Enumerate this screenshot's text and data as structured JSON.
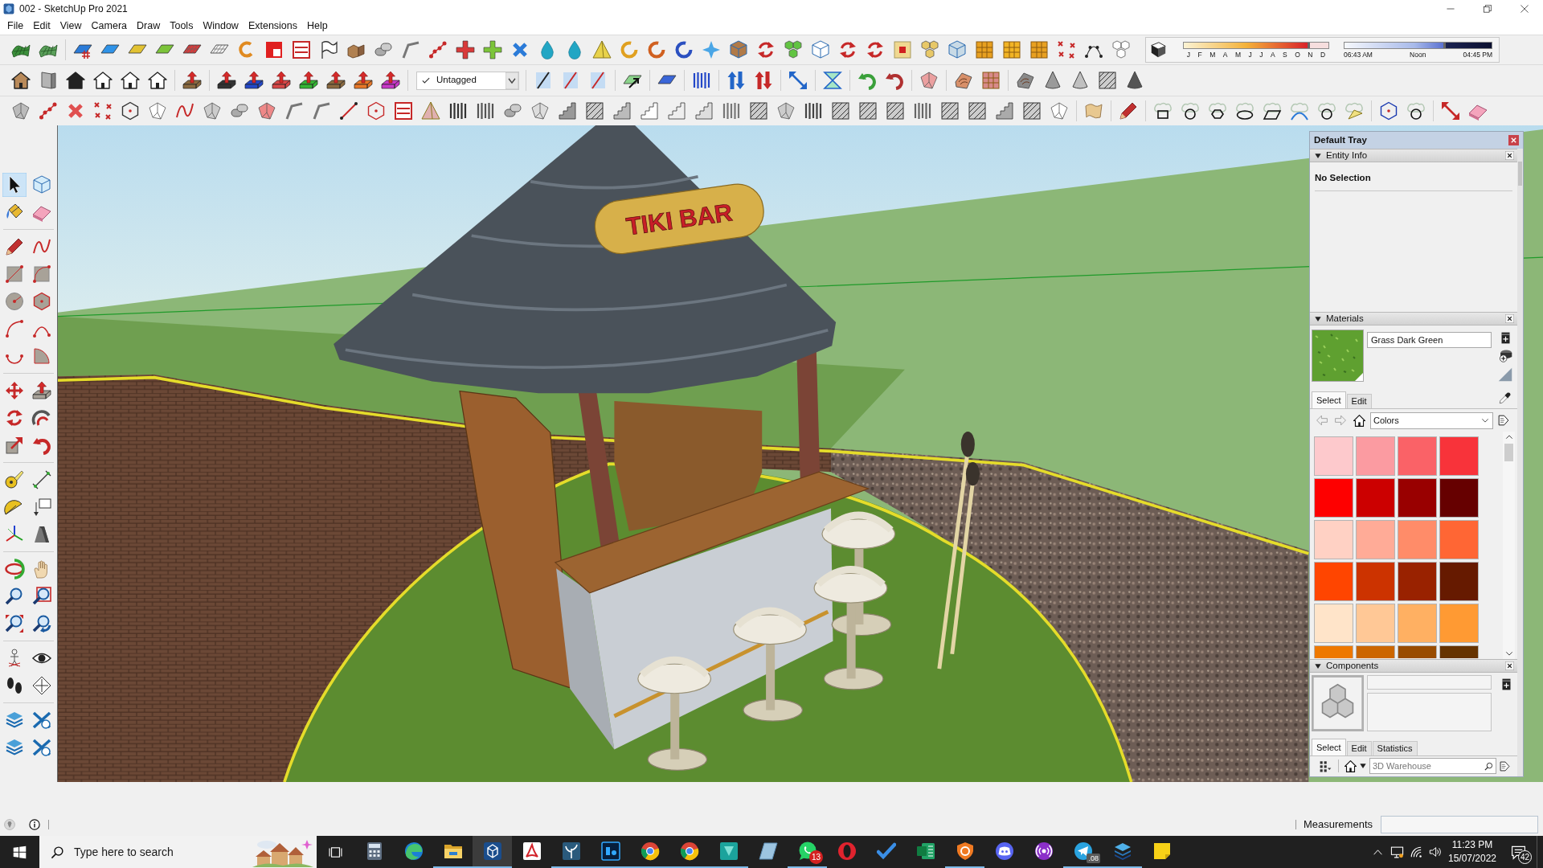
{
  "window": {
    "title": "002 - SketchUp Pro 2021"
  },
  "menu": [
    "File",
    "Edit",
    "View",
    "Camera",
    "Draw",
    "Tools",
    "Window",
    "Extensions",
    "Help"
  ],
  "toolbar": {
    "tag_dropdown": {
      "value": "Untagged"
    }
  },
  "shadow_settings": {
    "date_slider": {
      "level": 0.86,
      "months": [
        "J",
        "F",
        "M",
        "A",
        "M",
        "J",
        "J",
        "A",
        "S",
        "O",
        "N",
        "D"
      ]
    },
    "time_slider": {
      "level": 0.68,
      "start": "06:43 AM",
      "middle": "Noon",
      "end": "04:45 PM"
    }
  },
  "left_toolbar": {
    "tool_groups": [
      [
        {
          "selected": true
        },
        {
          "selected": false
        },
        {
          "selected": false
        },
        {
          "selected": false
        }
      ],
      [
        {
          "selected": false
        },
        {
          "selected": false
        },
        {
          "selected": false
        },
        {
          "selected": false
        },
        {
          "selected": false
        },
        {
          "selected": false
        },
        {
          "selected": false
        },
        {
          "selected": false
        },
        {
          "selected": false
        },
        {
          "selected": false
        }
      ],
      [
        {
          "selected": false
        },
        {
          "selected": false
        },
        {
          "selected": false
        },
        {
          "selected": false
        },
        {
          "selected": false
        },
        {
          "selected": false
        }
      ],
      [
        {
          "selected": false
        },
        {
          "selected": false
        },
        {
          "selected": false
        },
        {
          "selected": false
        },
        {
          "selected": false
        },
        {
          "selected": false
        }
      ],
      [
        {
          "selected": false
        },
        {
          "selected": false
        },
        {
          "selected": false
        },
        {
          "selected": false
        },
        {
          "selected": false
        },
        {
          "selected": false
        }
      ],
      [
        {
          "selected": false
        },
        {
          "selected": false
        },
        {
          "selected": false
        },
        {
          "selected": false
        }
      ],
      [
        {
          "selected": false
        },
        {
          "selected": false
        },
        {
          "selected": false
        },
        {
          "selected": false
        }
      ]
    ]
  },
  "viewport": {
    "sign_text": "TIKI BAR"
  },
  "tray": {
    "title": "Default Tray",
    "entity_info": {
      "title": "Entity Info",
      "selection": "No Selection"
    },
    "materials": {
      "title": "Materials",
      "name": "Grass Dark Green",
      "tabs": [
        {
          "label": "Select",
          "selected": true
        },
        {
          "label": "Edit",
          "selected": false
        }
      ],
      "library": "Colors",
      "swatches": [
        {
          "color": "#fdc9cc"
        },
        {
          "color": "#fb9ba1"
        },
        {
          "color": "#fa6267"
        },
        {
          "color": "#f8333a"
        },
        {
          "color": "#fe0000"
        },
        {
          "color": "#cc0000"
        },
        {
          "color": "#990000"
        },
        {
          "color": "#660000"
        },
        {
          "color": "#ffd1c4"
        },
        {
          "color": "#ffab97"
        },
        {
          "color": "#ff8c69"
        },
        {
          "color": "#ff6634"
        },
        {
          "color": "#ff4500"
        },
        {
          "color": "#cc3300"
        },
        {
          "color": "#992200"
        },
        {
          "color": "#661a00"
        },
        {
          "color": "#ffe4c9"
        },
        {
          "color": "#ffc896"
        },
        {
          "color": "#ffb062"
        },
        {
          "color": "#ff9a33"
        },
        {
          "color": "#ee7800"
        },
        {
          "color": "#cc6600"
        },
        {
          "color": "#994c00"
        },
        {
          "color": "#663300"
        }
      ]
    },
    "components": {
      "title": "Components",
      "tabs": [
        {
          "label": "Select",
          "selected": true
        },
        {
          "label": "Edit",
          "selected": false
        },
        {
          "label": "Statistics",
          "selected": false
        }
      ],
      "search": {
        "placeholder": "3D Warehouse"
      }
    }
  },
  "status_bar": {
    "measurements_label": "Measurements"
  },
  "taskbar": {
    "search": {
      "placeholder": "Type here to search"
    },
    "apps": [
      {
        "running": false,
        "selected": false
      },
      {
        "running": false,
        "selected": false
      },
      {
        "running": true,
        "selected": false
      },
      {
        "running": true,
        "selected": true
      },
      {
        "running": false,
        "selected": false
      },
      {
        "running": true,
        "selected": false
      },
      {
        "running": true,
        "selected": false
      },
      {
        "running": true,
        "selected": false
      },
      {
        "running": true,
        "selected": false
      },
      {
        "running": true,
        "selected": false
      },
      {
        "running": false,
        "selected": false
      },
      {
        "running": true,
        "selected": false,
        "badge": {
          "kind": "count",
          "text": "13"
        }
      },
      {
        "running": false,
        "selected": false
      },
      {
        "running": false,
        "selected": false
      },
      {
        "running": false,
        "selected": false
      },
      {
        "running": true,
        "selected": false
      },
      {
        "running": false,
        "selected": false
      },
      {
        "running": false,
        "selected": false
      },
      {
        "running": true,
        "selected": false,
        "badge": {
          "kind": "tag",
          "text": ".08"
        }
      },
      {
        "running": true,
        "selected": false
      },
      {
        "running": false,
        "selected": false
      }
    ],
    "clock": {
      "time": "11:23 PM",
      "date": "15/07/2022"
    },
    "notifications": "42"
  }
}
